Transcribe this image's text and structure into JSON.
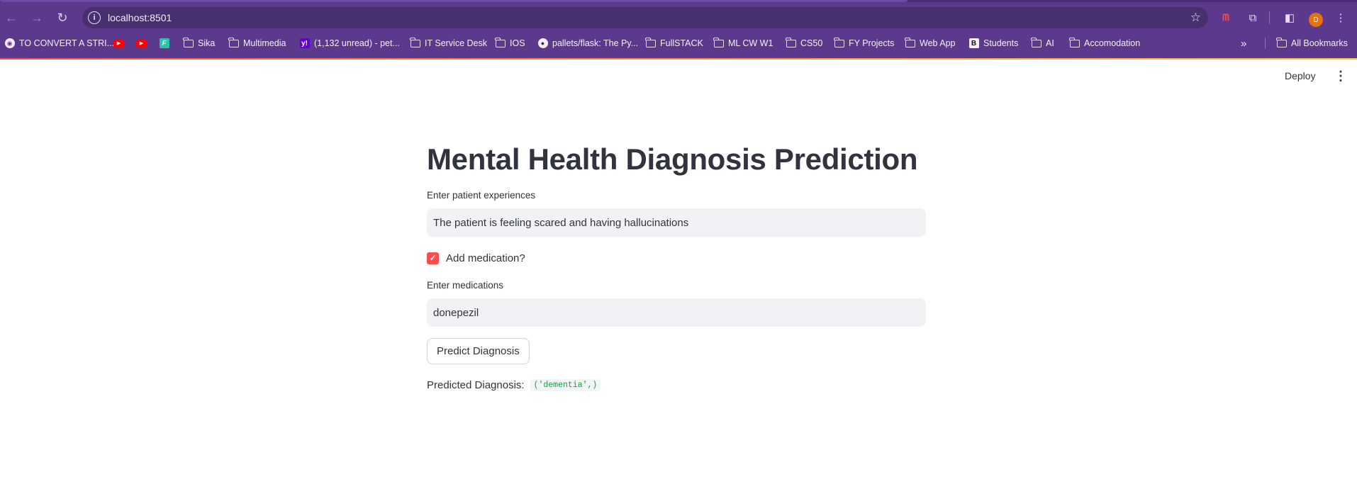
{
  "browser": {
    "url": "localhost:8501",
    "avatar_letter": "D",
    "bookmarks": [
      {
        "label": "TO CONVERT A STRI...",
        "icon": "globe-icon"
      },
      {
        "label": "",
        "icon": "youtube-icon"
      },
      {
        "label": "",
        "icon": "youtube-icon"
      },
      {
        "label": "",
        "icon": "f-icon"
      },
      {
        "label": "Sika",
        "icon": "folder-icon"
      },
      {
        "label": "Multimedia",
        "icon": "folder-icon"
      },
      {
        "label": "(1,132 unread) - pet...",
        "icon": "yahoo-icon"
      },
      {
        "label": "IT Service Desk",
        "icon": "folder-icon"
      },
      {
        "label": "IOS",
        "icon": "folder-icon"
      },
      {
        "label": "pallets/flask: The Py...",
        "icon": "github-icon"
      },
      {
        "label": "FullSTACK",
        "icon": "folder-icon"
      },
      {
        "label": "ML CW W1",
        "icon": "folder-icon"
      },
      {
        "label": "CS50",
        "icon": "folder-icon"
      },
      {
        "label": "FY Projects",
        "icon": "folder-icon"
      },
      {
        "label": "Web App",
        "icon": "folder-icon"
      },
      {
        "label": "Students",
        "icon": "b-icon"
      },
      {
        "label": "AI",
        "icon": "folder-icon"
      },
      {
        "label": "Accomodation",
        "icon": "folder-icon"
      }
    ],
    "all_bookmarks": "All Bookmarks"
  },
  "app": {
    "deploy_label": "Deploy",
    "title": "Mental Health Diagnosis Prediction",
    "experiences_label": "Enter patient experiences",
    "experiences_value": "The patient is feeling scared and having hallucinations",
    "medication_checkbox_label": "Add medication?",
    "medication_checked": true,
    "medications_label": "Enter medications",
    "medications_value": "donepezil",
    "predict_button": "Predict Diagnosis",
    "result_label": "Predicted Diagnosis:",
    "result_value": "('dementia',)"
  },
  "colors": {
    "browser_frame": "#5b3a8e",
    "accent": "#ff4b4b",
    "text": "#31333f",
    "input_bg": "#f0f2f6",
    "code_text": "#09ab3b"
  }
}
